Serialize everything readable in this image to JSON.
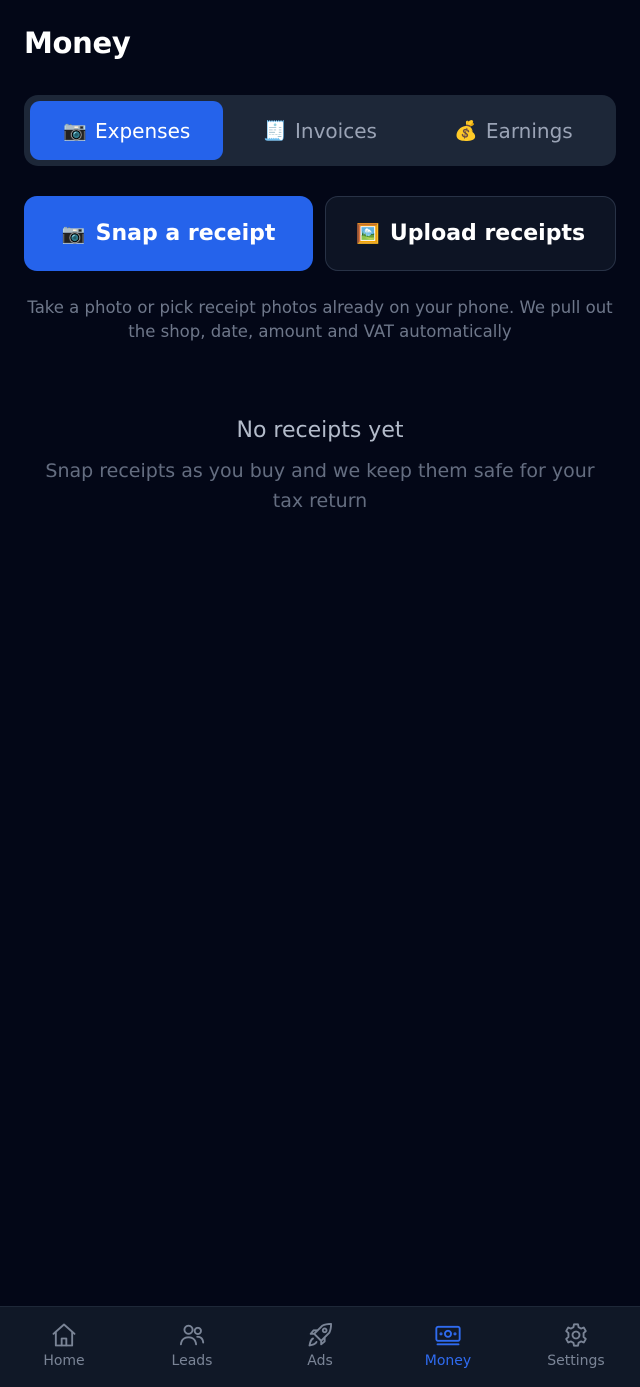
{
  "header": {
    "title": "Money"
  },
  "tabs": [
    {
      "label": "Expenses",
      "icon": "camera-icon",
      "glyph": "📷",
      "active": true
    },
    {
      "label": "Invoices",
      "icon": "receipt-icon",
      "glyph": "🧾",
      "active": false
    },
    {
      "label": "Earnings",
      "icon": "money-bag-icon",
      "glyph": "💰",
      "active": false
    }
  ],
  "actions": {
    "snap": {
      "label": "Snap a receipt",
      "icon": "camera-icon",
      "glyph": "📷"
    },
    "upload": {
      "label": "Upload receipts",
      "icon": "picture-icon",
      "glyph": "🖼️"
    }
  },
  "hint": "Take a photo or pick receipt photos already on your phone. We pull out the shop, date, amount and VAT automatically",
  "empty_state": {
    "title": "No receipts yet",
    "subtitle": "Snap receipts as you buy and we keep them safe for your tax return"
  },
  "nav": [
    {
      "label": "Home",
      "icon": "home-icon",
      "active": false
    },
    {
      "label": "Leads",
      "icon": "people-icon",
      "active": false
    },
    {
      "label": "Ads",
      "icon": "rocket-icon",
      "active": false
    },
    {
      "label": "Money",
      "icon": "money-icon",
      "active": true
    },
    {
      "label": "Settings",
      "icon": "gear-icon",
      "active": false
    }
  ],
  "colors": {
    "background": "#030717",
    "accent": "#2563eb",
    "nav_active": "#2f6bf0"
  }
}
